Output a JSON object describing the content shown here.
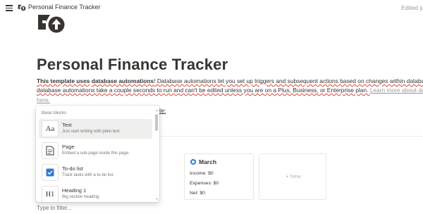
{
  "topbar": {
    "title": "Personal Finance Tracker",
    "edited": "Edited ju",
    "menu_icon": "hamburger-icon",
    "page_icon": "finance-logo-icon"
  },
  "page": {
    "title": "Personal Finance Tracker",
    "intro": {
      "l1_a": "This template uses",
      "l1_b": "database automations",
      "l1_c": "! Database automations let you set up triggers and subsequent actions based on changes within databa",
      "l2_a": "database automations take a couple seconds to run and can't be edited unless you are on a Plus, Business, or Enterprise plan. ",
      "l2_link": "Learn more about dat",
      "l3_link": "here.",
      "colon": "te:"
    }
  },
  "board": {
    "march_card": {
      "title": "March",
      "income": "Income: $0",
      "expenses": "Expenses: $0",
      "net": "Net: $0"
    },
    "new_label": "+ New"
  },
  "block_menu": {
    "section_label": "Basic blocks",
    "items": [
      {
        "label": "Text",
        "desc": "Just start writing with plain text.",
        "icon": "text-aa-icon",
        "glyph": "Aa"
      },
      {
        "label": "Page",
        "desc": "Embed a sub-page inside this page.",
        "icon": "page-icon"
      },
      {
        "label": "To-do list",
        "desc": "Track tasks with a to-do list.",
        "icon": "checkbox-icon"
      },
      {
        "label": "Heading 1",
        "desc": "Big section heading.",
        "icon": "heading-icon",
        "glyph": "H1"
      }
    ]
  },
  "filter": {
    "placeholder": "Type to filter..."
  },
  "colors": {
    "text": "#37352f",
    "muted": "#787774",
    "accent_blue": "#2e7bd4",
    "hover": "#efefee"
  }
}
